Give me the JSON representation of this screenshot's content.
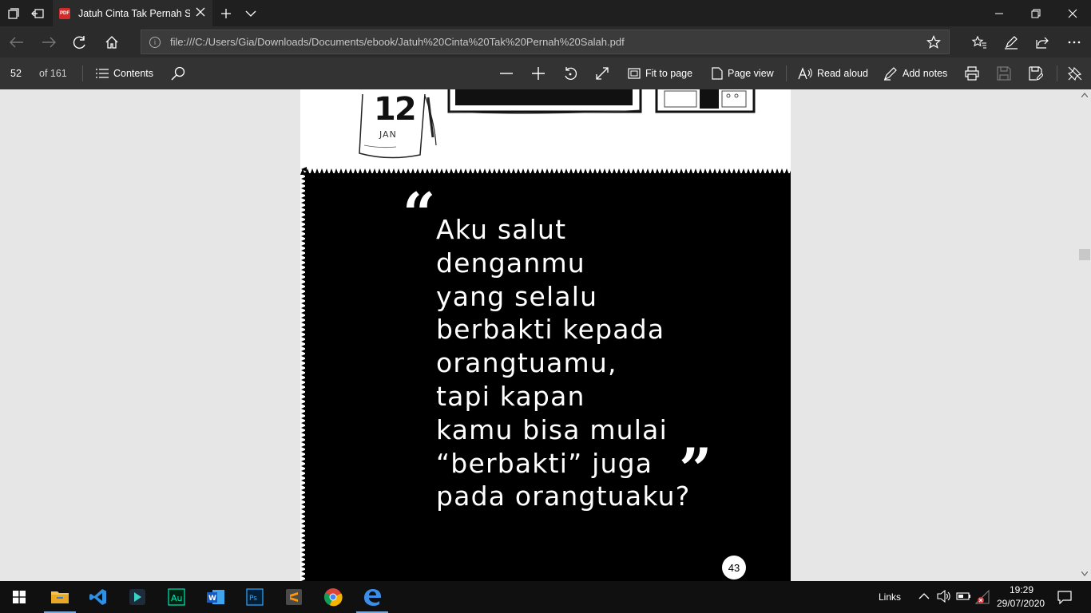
{
  "browser": {
    "tab_title": "Jatuh Cinta Tak Pernah Salah",
    "tab_icon": "pdf-icon",
    "url": "file:///C:/Users/Gia/Downloads/Documents/ebook/Jatuh%20Cinta%20Tak%20Pernah%20Salah.pdf"
  },
  "pdf_toolbar": {
    "current_page": "52",
    "total_pages": "of 161",
    "contents_label": "Contents",
    "fit_to_page_label": "Fit to page",
    "page_view_label": "Page view",
    "read_aloud_label": "Read aloud",
    "add_notes_label": "Add notes"
  },
  "page": {
    "calendar_day": "12",
    "calendar_month": "JAN",
    "quote_lines": [
      "Aku salut",
      "denganmu",
      "yang selalu",
      "berbakti kepada",
      "orangtuamu,",
      "tapi kapan",
      "kamu bisa mulai",
      "“berbakti” juga",
      "pada orangtuaku?"
    ],
    "open_quote": "“",
    "close_quote": "”",
    "page_number": "43"
  },
  "taskbar": {
    "apps": [
      "file-explorer",
      "vscode",
      "filmora",
      "audition",
      "word",
      "photoshop",
      "sublime-text",
      "chrome",
      "edge"
    ],
    "links_label": "Links",
    "time": "19:29",
    "date": "29/07/2020"
  },
  "colors": {
    "titlebar": "#1f1f1f",
    "toolbar": "#333333",
    "viewer_bg": "#e6e6e6",
    "panel": "#000000",
    "taskbar": "#101010"
  }
}
